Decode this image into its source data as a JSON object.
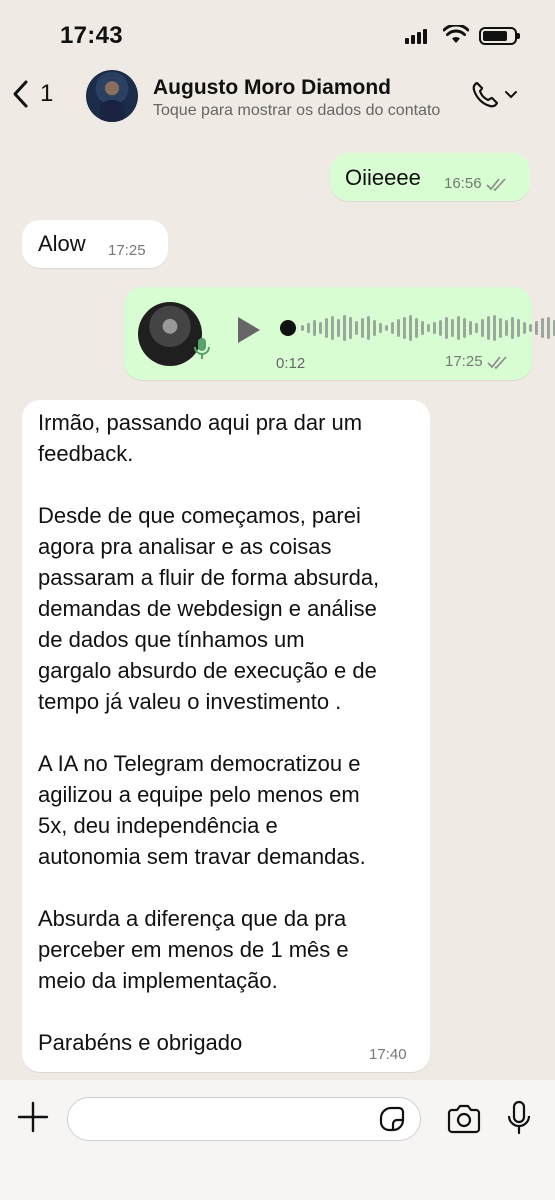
{
  "status_bar": {
    "time": "17:43"
  },
  "header": {
    "back_count": "1",
    "contact_name": "Augusto Moro Diamond",
    "subtitle": "Toque para mostrar os dados do contato"
  },
  "messages": [
    {
      "direction": "out",
      "text": "Oiieeee",
      "time": "16:56",
      "status": "read"
    },
    {
      "direction": "in",
      "text": "Alow",
      "time": "17:25"
    },
    {
      "direction": "out",
      "type": "voice",
      "duration": "0:12",
      "time": "17:25",
      "status": "read"
    },
    {
      "direction": "in",
      "text": "Irmão, passando aqui pra dar um\nfeedback.\n\nDesde de que começamos, parei\nagora pra analisar e as coisas\npassaram a fluir de forma absurda,\ndemandas de webdesign e análise\nde dados que tínhamos um\ngargalo absurdo de execução e de\ntempo já valeu o investimento .\n\nA IA no Telegram democratizou e\nagilizou a equipe pelo menos em\n5x, deu independência e\nautonomia sem travar demandas.\n\nAbsurda a diferença que da pra\nperceber em menos de 1 mês e\nmeio da implementação.\n\nParabéns e obrigado",
      "time": "17:40"
    }
  ],
  "input": {
    "value": ""
  },
  "colors": {
    "outgoing_bubble": "#d9fdd3",
    "incoming_bubble": "#ffffff",
    "background": "#efebe4"
  }
}
